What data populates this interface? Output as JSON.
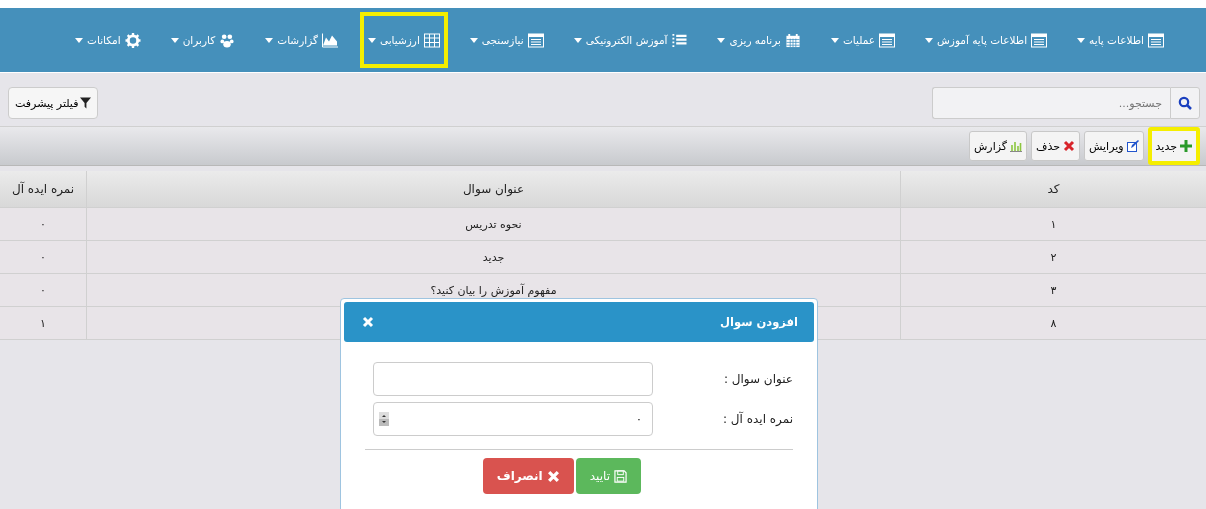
{
  "menu": [
    {
      "label": "اطلاعات پایه",
      "marked": false
    },
    {
      "label": "اطلاعات پایه آموزش",
      "marked": false
    },
    {
      "label": "عملیات",
      "marked": false
    },
    {
      "label": "برنامه ریزی",
      "marked": false
    },
    {
      "label": "آموزش الکترونیکی",
      "marked": false
    },
    {
      "label": "نیازسنجی",
      "marked": false
    },
    {
      "label": "ارزشیابی",
      "marked": true
    },
    {
      "label": "گزارشات",
      "marked": false
    },
    {
      "label": "کاربران",
      "marked": false
    },
    {
      "label": "امکانات",
      "marked": false
    }
  ],
  "search": {
    "placeholder": "جستجو..."
  },
  "filter_button": "فیلتر پیشرفت",
  "toolbar": [
    {
      "label": "جدید",
      "kind": "new",
      "marked": true
    },
    {
      "label": "ویرایش",
      "kind": "edit",
      "marked": false
    },
    {
      "label": "حذف",
      "kind": "delete",
      "marked": false
    },
    {
      "label": "گزارش",
      "kind": "report",
      "marked": false
    }
  ],
  "table": {
    "columns": [
      "کد",
      "عنوان سوال",
      "نمره ایده آل"
    ],
    "rows": [
      {
        "code": "۱",
        "title": "نحوه تدریس",
        "score": "۰"
      },
      {
        "code": "۲",
        "title": "جدید",
        "score": "۰"
      },
      {
        "code": "۳",
        "title": "مفهوم آموزش را بیان کنید؟",
        "score": "۰"
      },
      {
        "code": "۸",
        "score": "۱"
      }
    ]
  },
  "dialog": {
    "title": "افزودن سوال",
    "fields": [
      {
        "label": "عنوان سوال :",
        "kind": "text"
      },
      {
        "label": "نمره ایده آل :",
        "kind": "number",
        "value": "۰"
      }
    ],
    "buttons": [
      {
        "label": "تایید",
        "kind": "ok"
      },
      {
        "label": "انصراف",
        "kind": "cancel"
      }
    ]
  }
}
